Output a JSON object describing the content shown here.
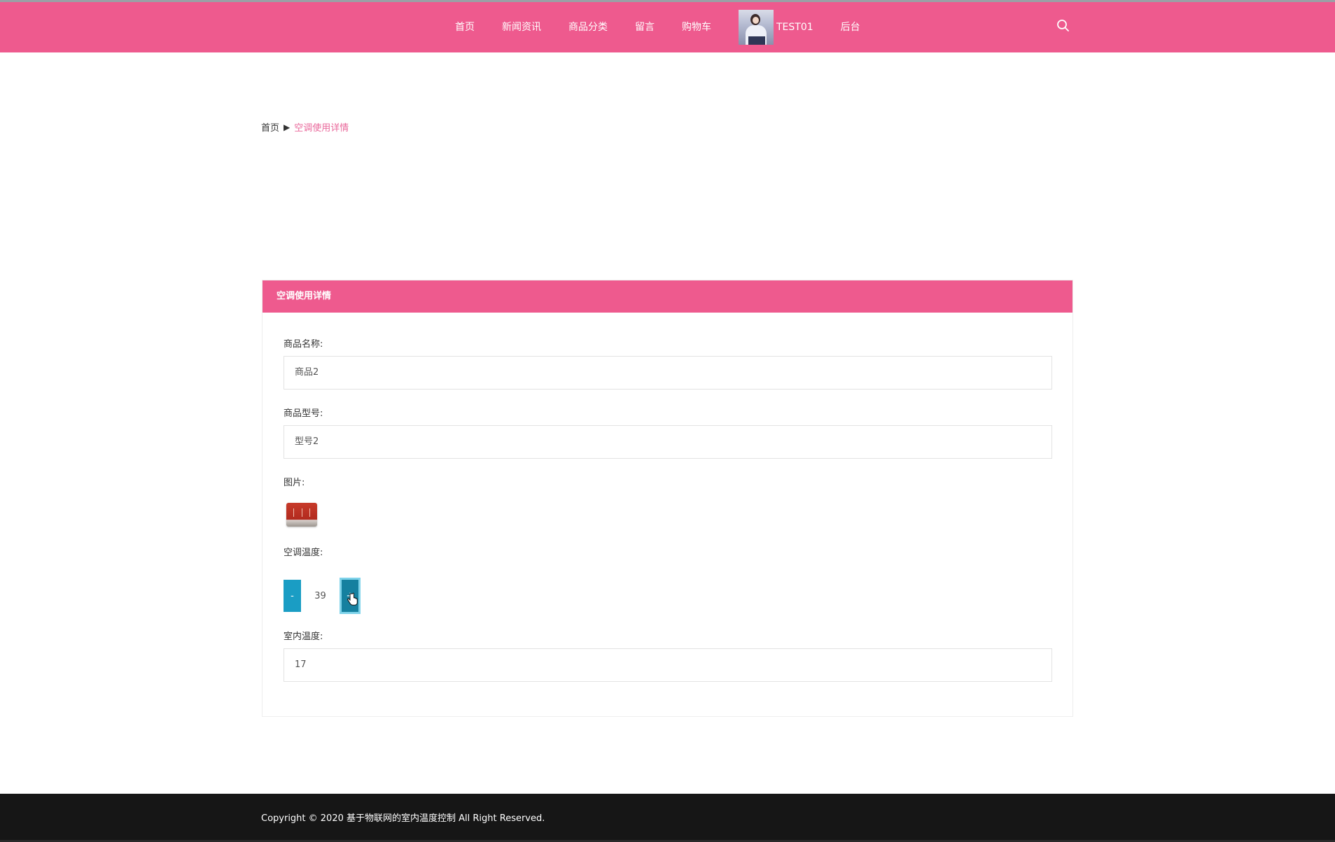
{
  "nav": {
    "items": [
      "首页",
      "新闻资讯",
      "商品分类",
      "留言",
      "购物车"
    ],
    "user_name": "TEST01",
    "admin_label": "后台"
  },
  "breadcrumb": {
    "home": "首页",
    "separator": "▶",
    "current": "空调使用详情"
  },
  "panel": {
    "title": "空调使用详情",
    "product_name_label": "商品名称:",
    "product_name_value": "商品2",
    "model_label": "商品型号:",
    "model_value": "型号2",
    "image_label": "图片:",
    "ac_temp_label": "空调温度:",
    "ac_temp_minus": "-",
    "ac_temp_value": "39",
    "ac_temp_plus": "+",
    "indoor_temp_label": "室内温度:",
    "indoor_temp_value": "17"
  },
  "footer": {
    "copyright": "Copyright © 2020 基于物联网的室内温度控制 All Right Reserved."
  },
  "colors": {
    "brand_pink": "#ee5a8e",
    "stepper_blue": "#1a9dc4",
    "footer_bg": "#161616"
  },
  "icons": {
    "search": "search-icon",
    "cursor": "hand-pointer-icon"
  }
}
